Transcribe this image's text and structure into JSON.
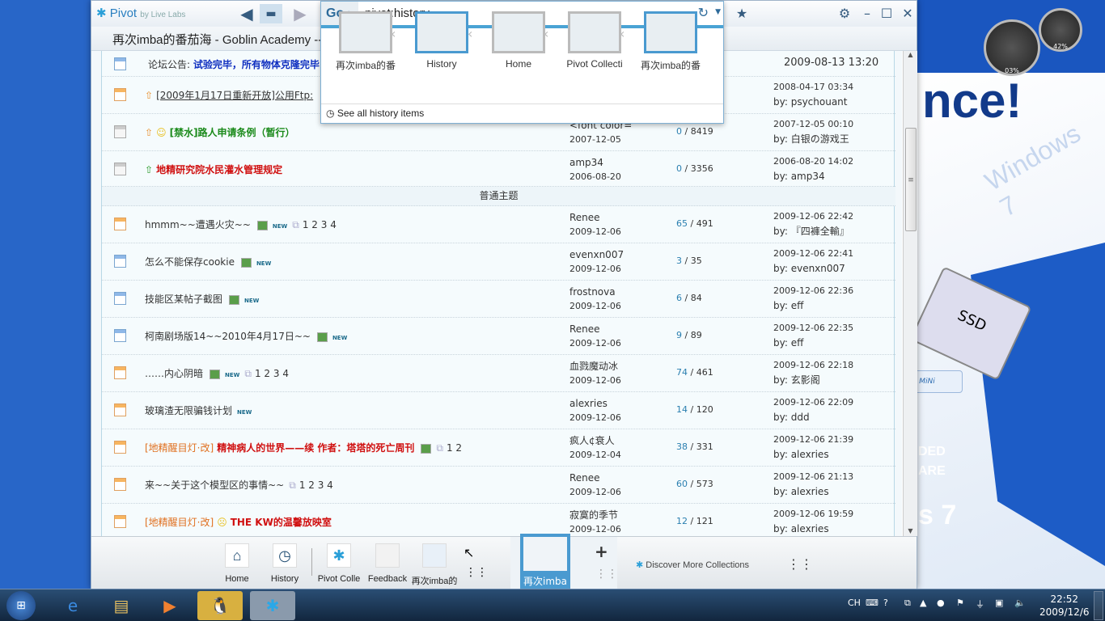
{
  "window": {
    "app_name": "Pivot",
    "app_sub": "by Live Labs",
    "page_title": "再次imba的番茄海 - Goblin Academy --"
  },
  "address": {
    "go_label": "Go ›",
    "value": "pivot:history",
    "history": [
      {
        "label": "再次imba的番"
      },
      {
        "label": "History"
      },
      {
        "label": "Home"
      },
      {
        "label": "Pivot Collecti"
      },
      {
        "label": "再次imba的番"
      }
    ],
    "see_all": "See all history items"
  },
  "announcement": {
    "label": "论坛公告:",
    "text": "试验完毕，所有物体克隆完毕",
    "time": "2009-08-13 13:20"
  },
  "sticky": [
    {
      "title": "[2009年1月17日重新开放]公用Ftp:",
      "last": "2008-04-17 03:34",
      "by": "by: psychouant"
    },
    {
      "title": "[禁水]路人申请条例（暂行）",
      "author": "<font color=",
      "date": "2007-12-05",
      "replies": "0",
      "views": "8419",
      "last": "2007-12-05 00:10",
      "by": "by: 白银の游戏王"
    },
    {
      "title": "地精研究院水民灌水管理规定",
      "author": "amp34",
      "date": "2006-08-20",
      "replies": "0",
      "views": "3356",
      "last": "2006-08-20 14:02",
      "by": "by: amp34"
    }
  ],
  "section": "普通主题",
  "threads": [
    {
      "prefix": "",
      "title": "hmmm~~遭遇火灾~~",
      "pic": true,
      "new": "NEW",
      "pages": "1 2 3 4",
      "author": "Renee",
      "date": "2009-12-06",
      "replies": "65",
      "views": "491",
      "last": "2009-12-06 22:42",
      "by": "by: 『四褲全輸』",
      "icon": "hot"
    },
    {
      "prefix": "",
      "title": "怎么不能保存cookie",
      "pic": true,
      "new": "NEW",
      "pages": "",
      "author": "evenxn007",
      "date": "2009-12-06",
      "replies": "3",
      "views": "35",
      "last": "2009-12-06 22:41",
      "by": "by: evenxn007",
      "icon": "normal"
    },
    {
      "prefix": "",
      "title": "技能区某帖子截图",
      "pic": true,
      "new": "NEW",
      "pages": "",
      "author": "frostnova",
      "date": "2009-12-06",
      "replies": "6",
      "views": "84",
      "last": "2009-12-06 22:36",
      "by": "by: eff",
      "icon": "normal"
    },
    {
      "prefix": "",
      "title": "柯南剧场版14~~2010年4月17日~~",
      "pic": true,
      "new": "NEW",
      "pages": "",
      "author": "Renee",
      "date": "2009-12-06",
      "replies": "9",
      "views": "89",
      "last": "2009-12-06 22:35",
      "by": "by: eff",
      "icon": "normal"
    },
    {
      "prefix": "",
      "title": "……内心阴暗",
      "pic": true,
      "new": "NEW",
      "pages": "1 2 3 4",
      "author": "血戮魔动冰",
      "date": "2009-12-06",
      "replies": "74",
      "views": "461",
      "last": "2009-12-06 22:18",
      "by": "by: 玄影阁",
      "icon": "hot"
    },
    {
      "prefix": "",
      "title": "玻璃渣无限骗钱计划",
      "pic": false,
      "new": "NEW",
      "pages": "",
      "author": "alexries",
      "date": "2009-12-06",
      "replies": "14",
      "views": "120",
      "last": "2009-12-06 22:09",
      "by": "by: ddd",
      "icon": "hot"
    },
    {
      "prefix": "[地精醒目灯·改]",
      "title": "精神病人的世界——续 作者：塔塔的死亡周刊",
      "red": true,
      "pic": true,
      "new": "",
      "pages": "1 2",
      "author": "疯人¢衰人",
      "date": "2009-12-04",
      "replies": "38",
      "views": "331",
      "last": "2009-12-06 21:39",
      "by": "by: alexries",
      "icon": "hot"
    },
    {
      "prefix": "",
      "title": "来~~关于这个模型区的事情~~",
      "pic": false,
      "new": "",
      "pages": "1 2 3 4",
      "author": "Renee",
      "date": "2009-12-06",
      "replies": "60",
      "views": "573",
      "last": "2009-12-06 21:13",
      "by": "by: alexries",
      "icon": "hot"
    },
    {
      "prefix": "[地精醒目灯·改]",
      "title": "THE KW的温馨放映室",
      "red": true,
      "pic": false,
      "new": "",
      "pages": "",
      "author": "寂寞的季节",
      "date": "2009-12-06",
      "replies": "12",
      "views": "121",
      "last": "2009-12-06 19:59",
      "by": "by: alexries",
      "icon": "hot"
    }
  ],
  "dock": {
    "items": [
      "Home",
      "History",
      "Pivot Colle",
      "Feedback",
      "再次imba的"
    ],
    "current": "再次imba",
    "discover": "Discover More Collections"
  },
  "desktop": {
    "headline": "nce!",
    "mini": "MiNi",
    "gauge1": "03%",
    "gauge2": "42%",
    "ssd": "SSD",
    "side1": "DED",
    "side2": "ARE",
    "side3": "s 7"
  },
  "taskbar": {
    "lang": "CH",
    "time": "22:52",
    "date": "2009/12/6"
  }
}
